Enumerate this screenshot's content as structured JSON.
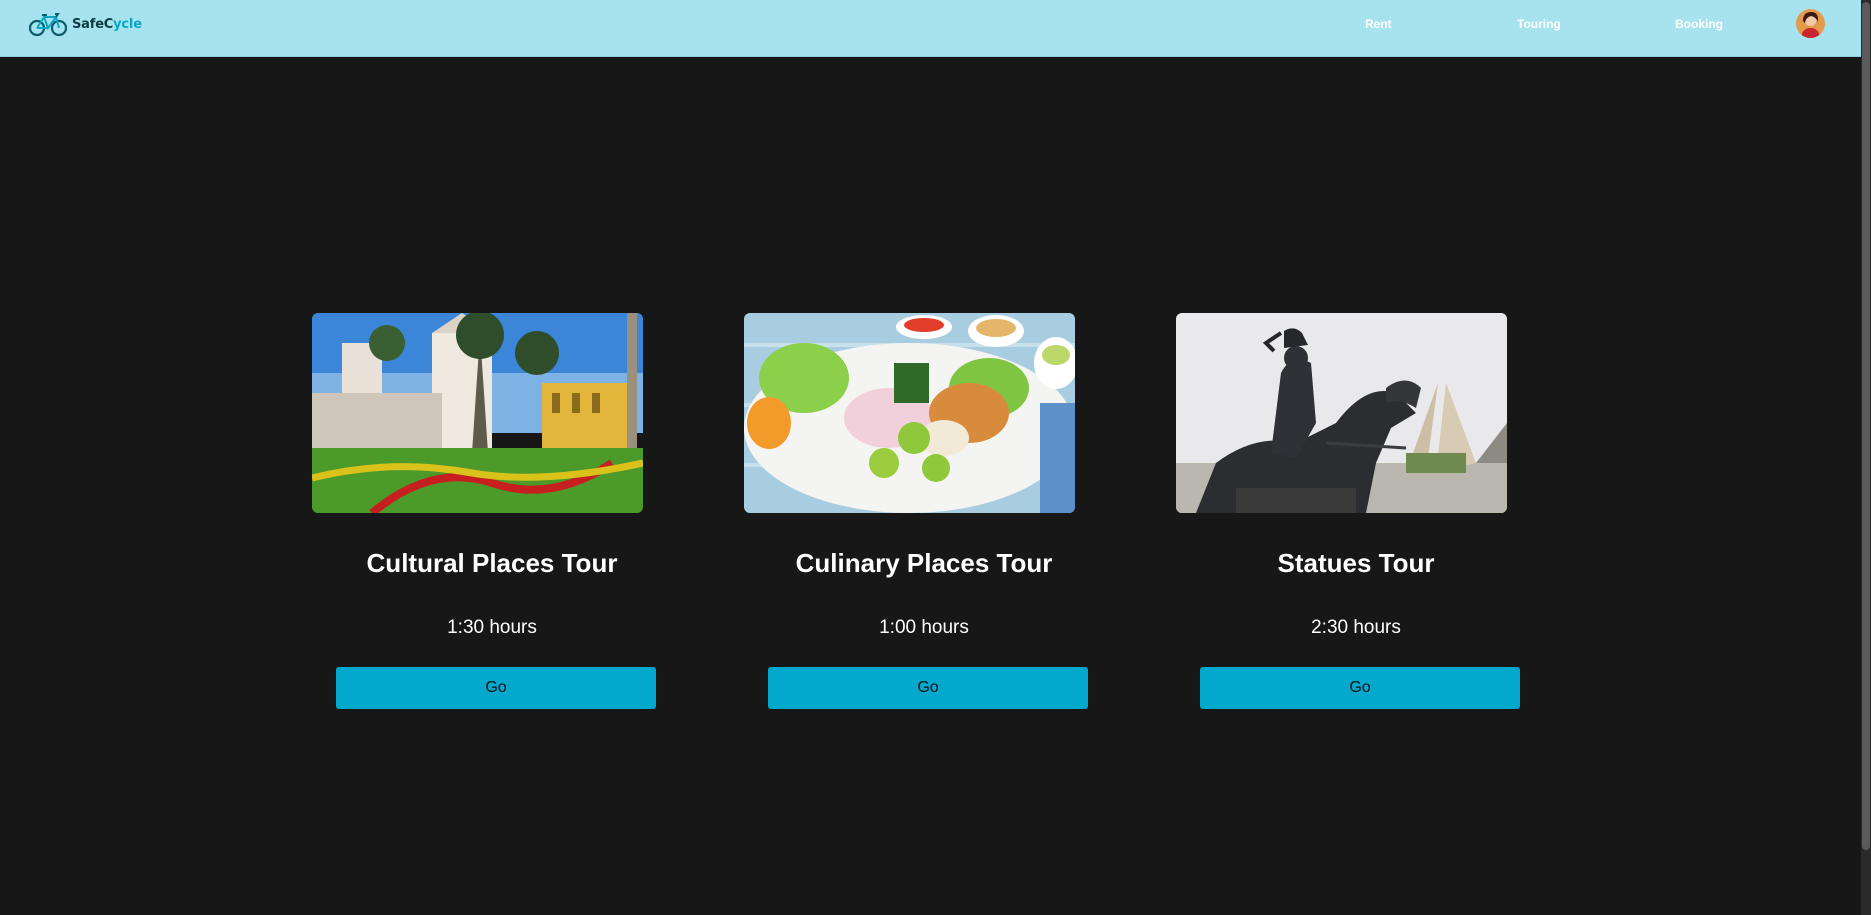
{
  "brand": {
    "name_part1": "SafeC",
    "name_part2": "ycle",
    "logo_icon": "bicycle-icon",
    "colors": {
      "dark": "#0c3b45",
      "accent": "#0aa7c5"
    }
  },
  "header": {
    "background": "#a7e3ee",
    "nav": [
      {
        "label": "Rent"
      },
      {
        "label": "Touring"
      },
      {
        "label": "Booking"
      }
    ],
    "avatar_icon": "user-avatar"
  },
  "tours": [
    {
      "title": "Cultural Places Tour",
      "duration": "1:30 hours",
      "button": "Go",
      "image": "cathedral-plaza-photo"
    },
    {
      "title": "Culinary Places Tour",
      "duration": "1:00 hours",
      "button": "Go",
      "image": "ceviche-dish-photo"
    },
    {
      "title": "Statues Tour",
      "duration": "2:30 hours",
      "button": "Go",
      "image": "horse-rider-statue-photo"
    }
  ],
  "theme": {
    "page_background": "#171718",
    "button_color": "#02a9cc"
  }
}
